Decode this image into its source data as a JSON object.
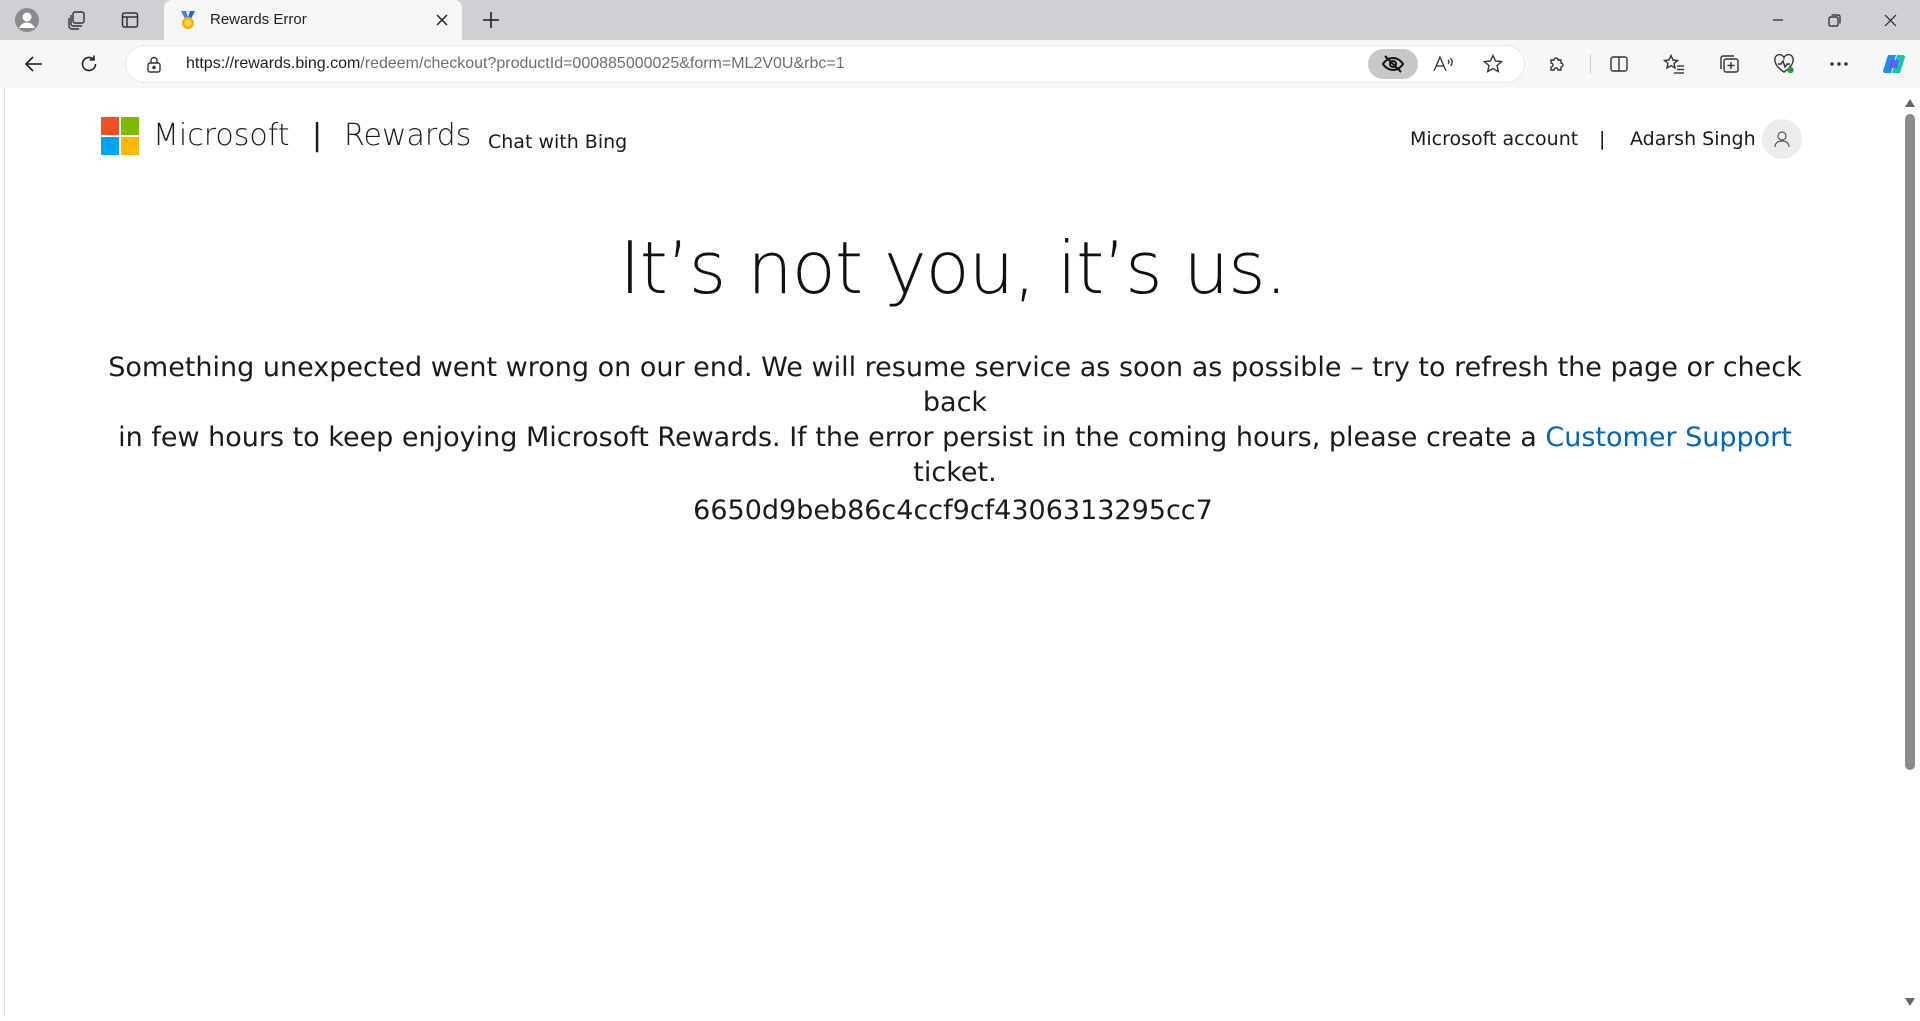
{
  "browser": {
    "tab": {
      "title": "Rewards Error"
    },
    "address_bar": {
      "url_host": "https://rewards.bing.com",
      "url_path": "/redeem/checkout?productId=000885000025&form=ML2V0U&rbc=1"
    }
  },
  "header": {
    "brand_name": "Microsoft",
    "separator": "|",
    "product_name": "Rewards",
    "chat_link": "Chat with Bing",
    "account_link": "Microsoft account",
    "account_separator": "|",
    "user_name": "Adarsh Singh"
  },
  "error": {
    "headline": "It’s not you, it’s us.",
    "message_line1": "Something unexpected went wrong on our end. We will resume service as soon as possible – try to refresh the page or check back",
    "message_line2_before": "in few hours to keep enjoying Microsoft Rewards. If the error persist in the coming hours, please create a ",
    "support_link": "Customer Support",
    "message_line2_after": " ticket.",
    "code": "6650d9beb86c4ccf9cf4306313295cc7"
  },
  "colors": {
    "link": "#0067b8",
    "logo_red": "#f25022",
    "logo_green": "#7fba00",
    "logo_blue": "#00a4ef",
    "logo_yellow": "#ffb900"
  }
}
